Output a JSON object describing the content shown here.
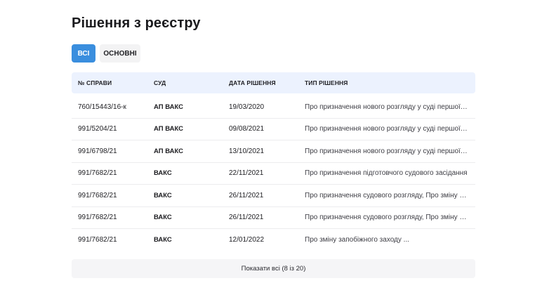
{
  "page": {
    "title": "Рішення з реєстру"
  },
  "tabs": [
    {
      "label": "ВСІ",
      "active": true
    },
    {
      "label": "ОСНОВНІ",
      "active": false
    }
  ],
  "table": {
    "headers": [
      "№ СПРАВИ",
      "СУД",
      "ДАТА РІШЕННЯ",
      "ТИП РІШЕННЯ"
    ],
    "rows": [
      {
        "case": "760/15443/16-к",
        "court": "АП ВАКС",
        "date": "19/03/2020",
        "type": "Про призначення нового розгляду у суді першої ін..."
      },
      {
        "case": "991/5204/21",
        "court": "АП ВАКС",
        "date": "09/08/2021",
        "type": "Про призначення нового розгляду у суді першої ін..."
      },
      {
        "case": "991/6798/21",
        "court": "АП ВАКС",
        "date": "13/10/2021",
        "type": "Про призначення нового розгляду у суді першої ін..."
      },
      {
        "case": "991/7682/21",
        "court": "ВАКС",
        "date": "22/11/2021",
        "type": "Про призначення підготовчого судового засідання"
      },
      {
        "case": "991/7682/21",
        "court": "ВАКС",
        "date": "26/11/2021",
        "type": "Про призначення судового розгляду, Про зміну за..."
      },
      {
        "case": "991/7682/21",
        "court": "ВАКС",
        "date": "26/11/2021",
        "type": "Про призначення судового розгляду, Про зміну за..."
      },
      {
        "case": "991/7682/21",
        "court": "ВАКС",
        "date": "12/01/2022",
        "type": "Про зміну запобіжного заходу ..."
      }
    ]
  },
  "footer": {
    "show_all_label": "Показати всі (8 із 20)"
  },
  "colors": {
    "accent": "#3a8ede",
    "header_bg": "#ecf2fe",
    "tab_inactive_bg": "#f3f3f4"
  }
}
